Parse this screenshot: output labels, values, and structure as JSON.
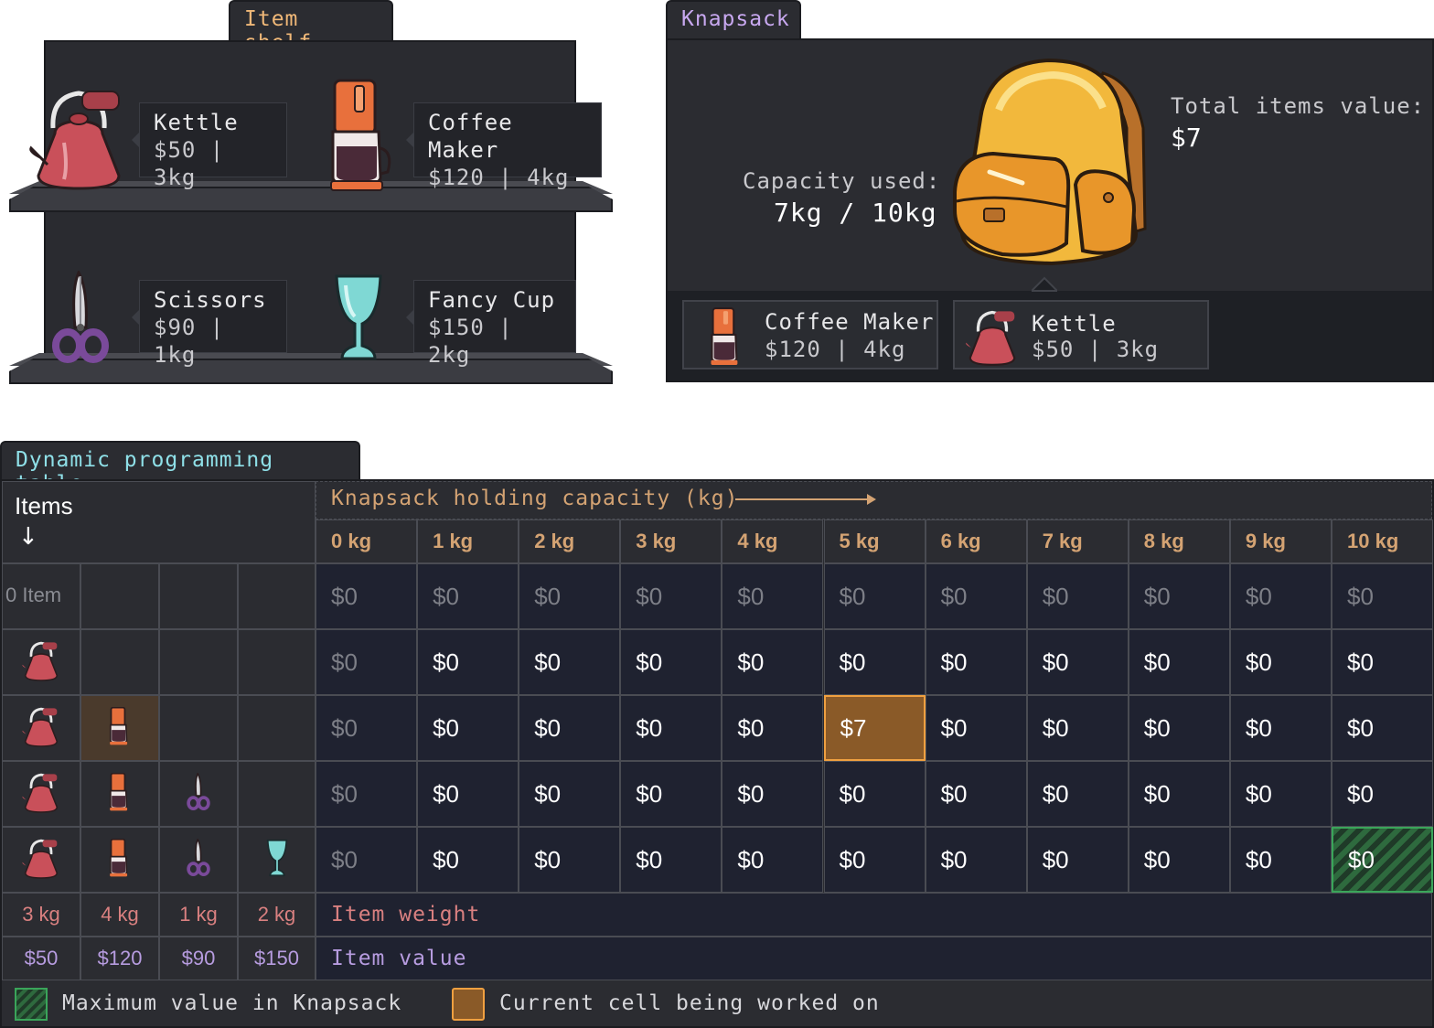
{
  "shelf": {
    "tab_title": "Item shelf",
    "items": [
      {
        "name": "Kettle",
        "detail": "$50 | 3kg",
        "icon": "kettle-icon"
      },
      {
        "name": "Coffee Maker",
        "detail": "$120 | 4kg",
        "icon": "coffee-maker-icon"
      },
      {
        "name": "Scissors",
        "detail": "$90 | 1kg",
        "icon": "scissors-icon"
      },
      {
        "name": "Fancy Cup",
        "detail": "$150 | 2kg",
        "icon": "fancy-cup-icon"
      }
    ]
  },
  "knapsack": {
    "tab_title": "Knapsack",
    "value_label": "Total items value:",
    "value": "$7",
    "capacity_label": "Capacity used:",
    "capacity": "7kg / 10kg",
    "contents": [
      {
        "name": "Coffee Maker",
        "price": "$120",
        "sep": "|",
        "weight": "4kg",
        "icon": "coffee-maker-icon"
      },
      {
        "name": "Kettle",
        "price": "$50",
        "sep": "|",
        "weight": "3kg",
        "icon": "kettle-icon"
      }
    ]
  },
  "dp": {
    "tab_title": "Dynamic programming table",
    "items_header": "Items",
    "capacity_header": "Knapsack holding capacity (kg)",
    "columns": [
      "0 kg",
      "1 kg",
      "2 kg",
      "3 kg",
      "4 kg",
      "5 kg",
      "6 kg",
      "7 kg",
      "8 kg",
      "9 kg",
      "10 kg"
    ],
    "row0_label": "0 Item",
    "rows": [
      [
        "$0",
        "$0",
        "$0",
        "$0",
        "$0",
        "$0",
        "$0",
        "$0",
        "$0",
        "$0",
        "$0"
      ],
      [
        "$0",
        "$0",
        "$0",
        "$0",
        "$0",
        "$0",
        "$0",
        "$0",
        "$0",
        "$0",
        "$0"
      ],
      [
        "$0",
        "$0",
        "$0",
        "$0",
        "$0",
        "$7",
        "$0",
        "$0",
        "$0",
        "$0",
        "$0"
      ],
      [
        "$0",
        "$0",
        "$0",
        "$0",
        "$0",
        "$0",
        "$0",
        "$0",
        "$0",
        "$0",
        "$0"
      ],
      [
        "$0",
        "$0",
        "$0",
        "$0",
        "$0",
        "$0",
        "$0",
        "$0",
        "$0",
        "$0",
        "$0"
      ]
    ],
    "current_cell": {
      "row": 2,
      "col": 5
    },
    "max_cell": {
      "row": 4,
      "col": 10
    },
    "item_weights": [
      "3 kg",
      "4 kg",
      "1 kg",
      "2 kg"
    ],
    "item_values": [
      "$50",
      "$120",
      "$90",
      "$150"
    ],
    "weight_row_label": "Item weight",
    "value_row_label": "Item value",
    "colors": {
      "current": "#8a5a28",
      "current_border": "#f0a040",
      "max": "#2a8a4a",
      "weight": "#d98080",
      "value": "#b79ce0",
      "header": "#d4a373"
    }
  },
  "legend": {
    "max_label": "Maximum value in Knapsack",
    "current_label": "Current cell being worked on"
  }
}
